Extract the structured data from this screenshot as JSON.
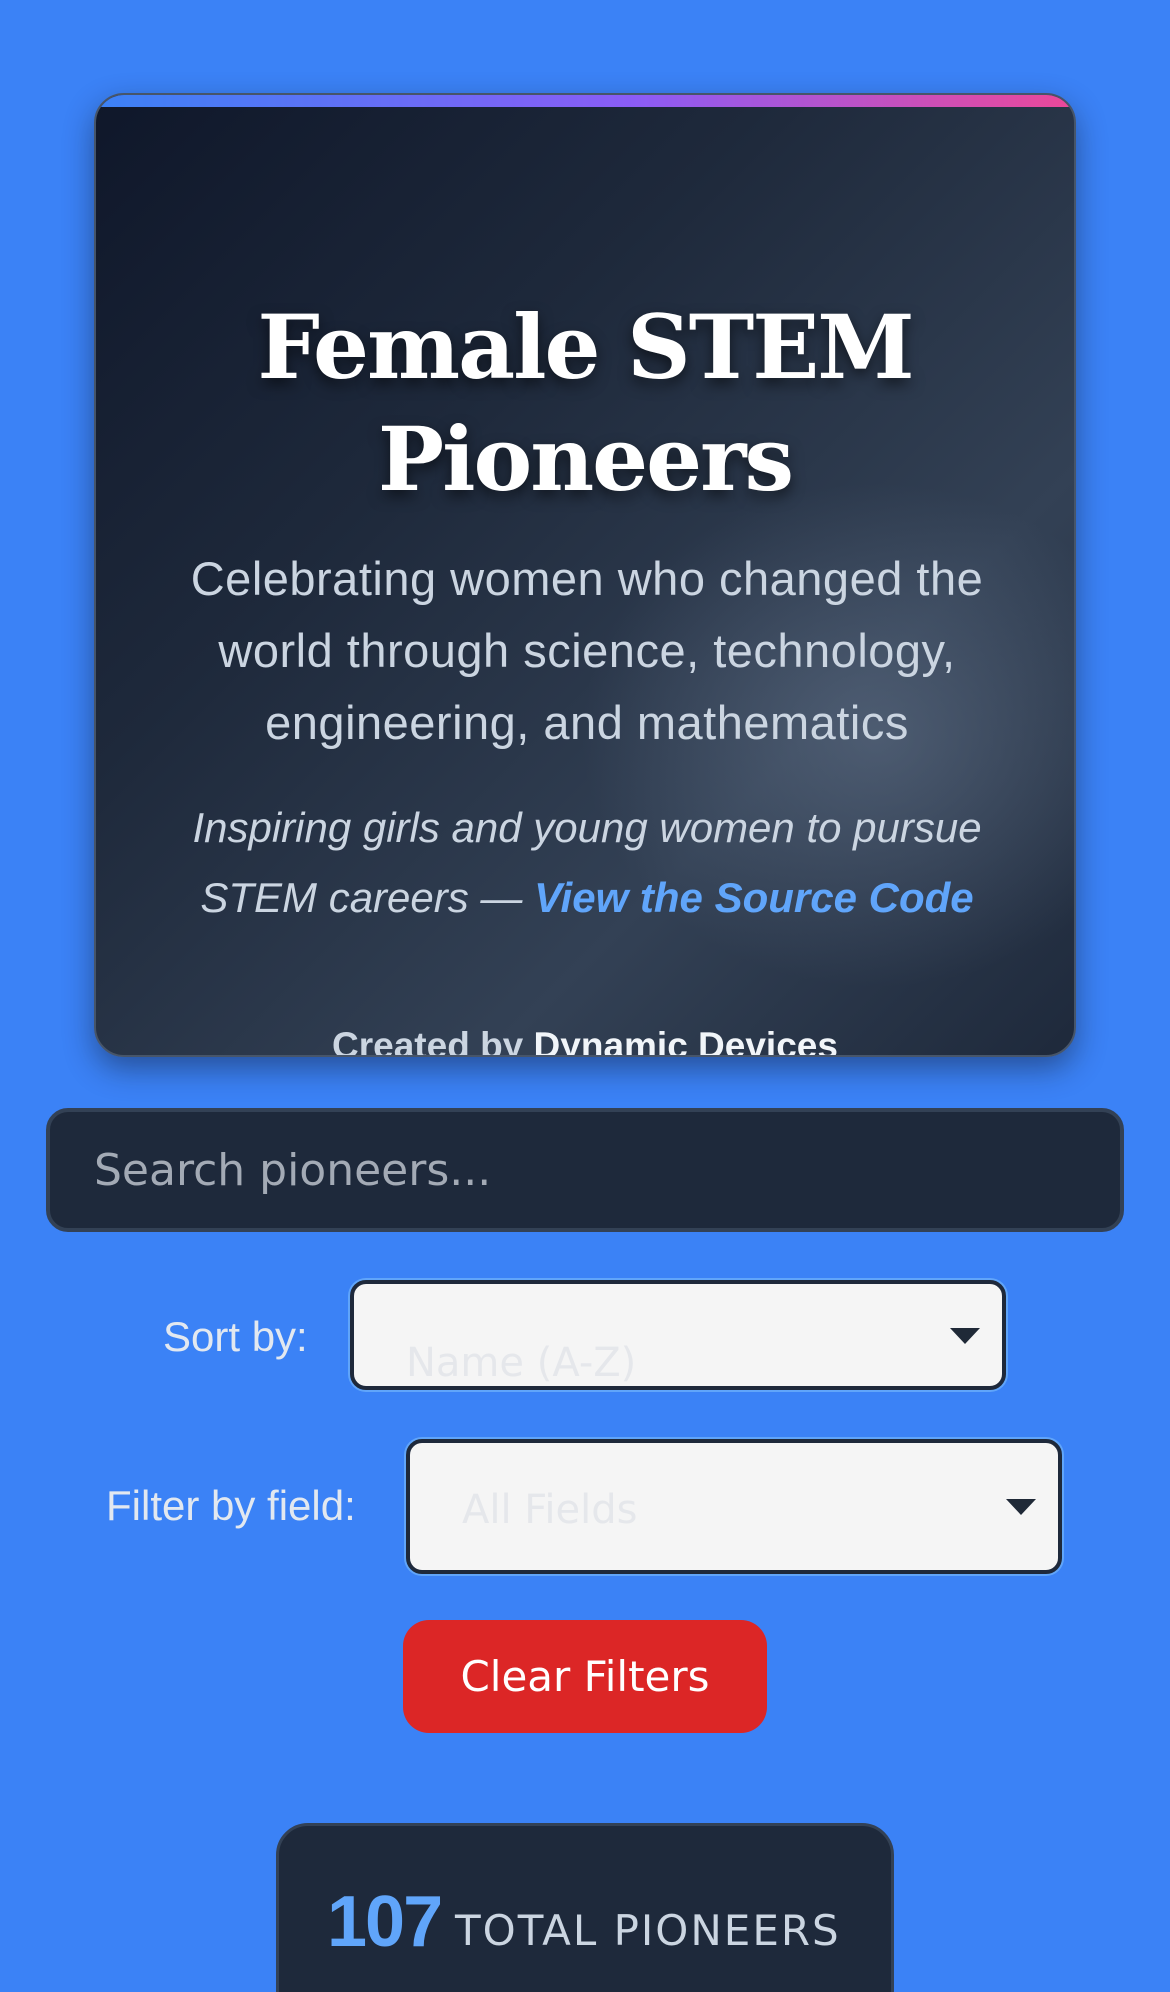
{
  "hero": {
    "title_line1": "Female STEM",
    "title_line2": "Pioneers",
    "subtitle": "Celebrating women who changed the world through science, technology, engineering, and mathematics",
    "tagline_text": "Inspiring girls and young women to pursue STEM careers — ",
    "tagline_link": "View the Source Code",
    "credit_prefix": "Created by ",
    "credit_brand": "Dynamic Devices"
  },
  "search": {
    "placeholder": "Search pioneers...",
    "value": ""
  },
  "sort": {
    "label": "Sort by:",
    "selected": "Name (A-Z)"
  },
  "filter": {
    "label": "Filter by field:",
    "selected": "All Fields"
  },
  "actions": {
    "clear_label": "Clear Filters"
  },
  "stats": {
    "total": "107",
    "label": "TOTAL PIONEERS"
  },
  "colors": {
    "background": "#3b82f6",
    "card": "#1e293b",
    "accent": "#60a5fa",
    "danger": "#dc2626"
  }
}
